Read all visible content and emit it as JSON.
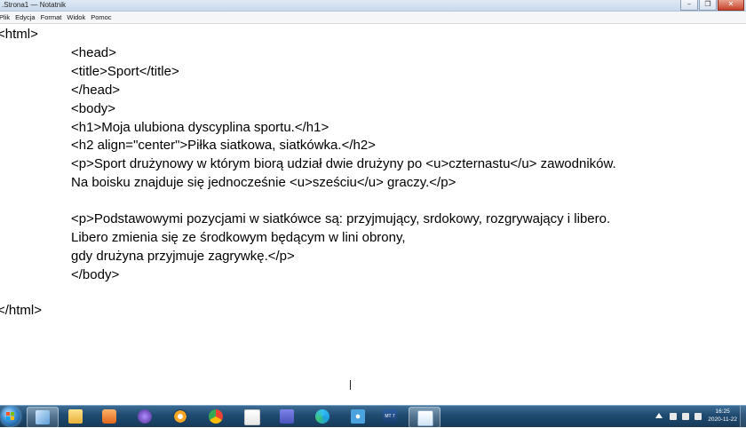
{
  "window": {
    "title": ".Strona1 — Notatnik",
    "controls": {
      "minimize": "–",
      "maximize": "❐",
      "close": "✕"
    }
  },
  "menu": [
    "Plik",
    "Edycja",
    "Format",
    "Widok",
    "Pomoc"
  ],
  "document": {
    "lines": [
      "<html>",
      "<head>",
      "<title>Sport</title>",
      "</head>",
      "<body>",
      "<h1>Moja ulubiona dyscyplina sportu.</h1>",
      "<h2 align=\"center\">Piłka siatkowa, siatkówka.</h2>",
      "<p>Sport drużynowy w którym biorą udział dwie drużyny po <u>czternastu</u> zawodników.",
      "Na boisku znajduje się jednocześnie <u>sześciu</u> graczy.</p>",
      "",
      "<p>Podstawowymi pozycjami w siatkówce są: przyjmujący, srdokowy, rozgrywający i libero.",
      "Libero zmienia się ze środkowym będącym w lini obrony,",
      "gdy drużyna przyjmuje zagrywkę.</p>",
      "</body>",
      "",
      "</html>"
    ]
  },
  "taskbar": {
    "apps": [
      {
        "icon": "windows-explorer-icon",
        "active": true
      },
      {
        "icon": "folder-icon",
        "active": false
      },
      {
        "icon": "media-player-icon",
        "active": false
      },
      {
        "icon": "wizard-icon",
        "active": false
      },
      {
        "icon": "blender-icon",
        "active": false
      },
      {
        "icon": "chrome-icon",
        "active": false
      },
      {
        "icon": "paint-icon",
        "active": false
      },
      {
        "icon": "teams-icon",
        "active": false
      },
      {
        "icon": "edge-icon",
        "active": false
      },
      {
        "icon": "snowflake-app-icon",
        "active": false
      },
      {
        "icon": "mt7-app-icon",
        "active": false
      },
      {
        "icon": "notepad-icon",
        "active": true
      }
    ],
    "badge_text": "MT 7",
    "clock": {
      "time": "16:25",
      "date": "2020-11-22"
    }
  },
  "colors": {
    "taskbar": "#1f4a70",
    "text": "#000000"
  }
}
